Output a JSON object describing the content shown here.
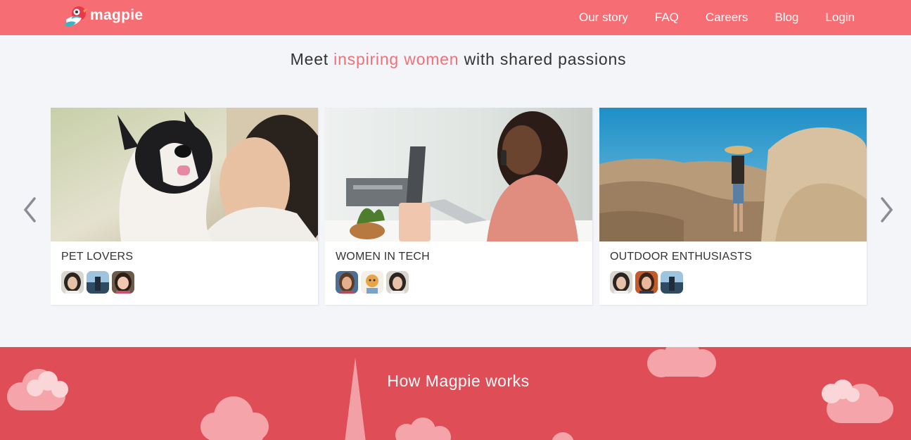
{
  "brand": {
    "name": "magpie",
    "color": "#f76d74"
  },
  "nav": {
    "items": [
      "Our story",
      "FAQ",
      "Careers",
      "Blog",
      "Login"
    ]
  },
  "headline": {
    "before": "Meet ",
    "accent": "inspiring women",
    "after": " with shared passions",
    "accent_color": "#f0717a"
  },
  "carousel": {
    "prev_icon": "chevron-left-icon",
    "next_icon": "chevron-right-icon",
    "cards": [
      {
        "title": "PET LOVERS",
        "photo": "woman-with-french-bulldog",
        "avatars": 3
      },
      {
        "title": "WOMEN IN TECH",
        "photo": "woman-on-phone-at-laptop",
        "avatars": 3
      },
      {
        "title": "OUTDOOR ENTHUSIASTS",
        "photo": "hiker-on-desert-rocks",
        "avatars": 3
      }
    ]
  },
  "how_it_works": {
    "title": "How Magpie works",
    "background": "#df4e57"
  }
}
